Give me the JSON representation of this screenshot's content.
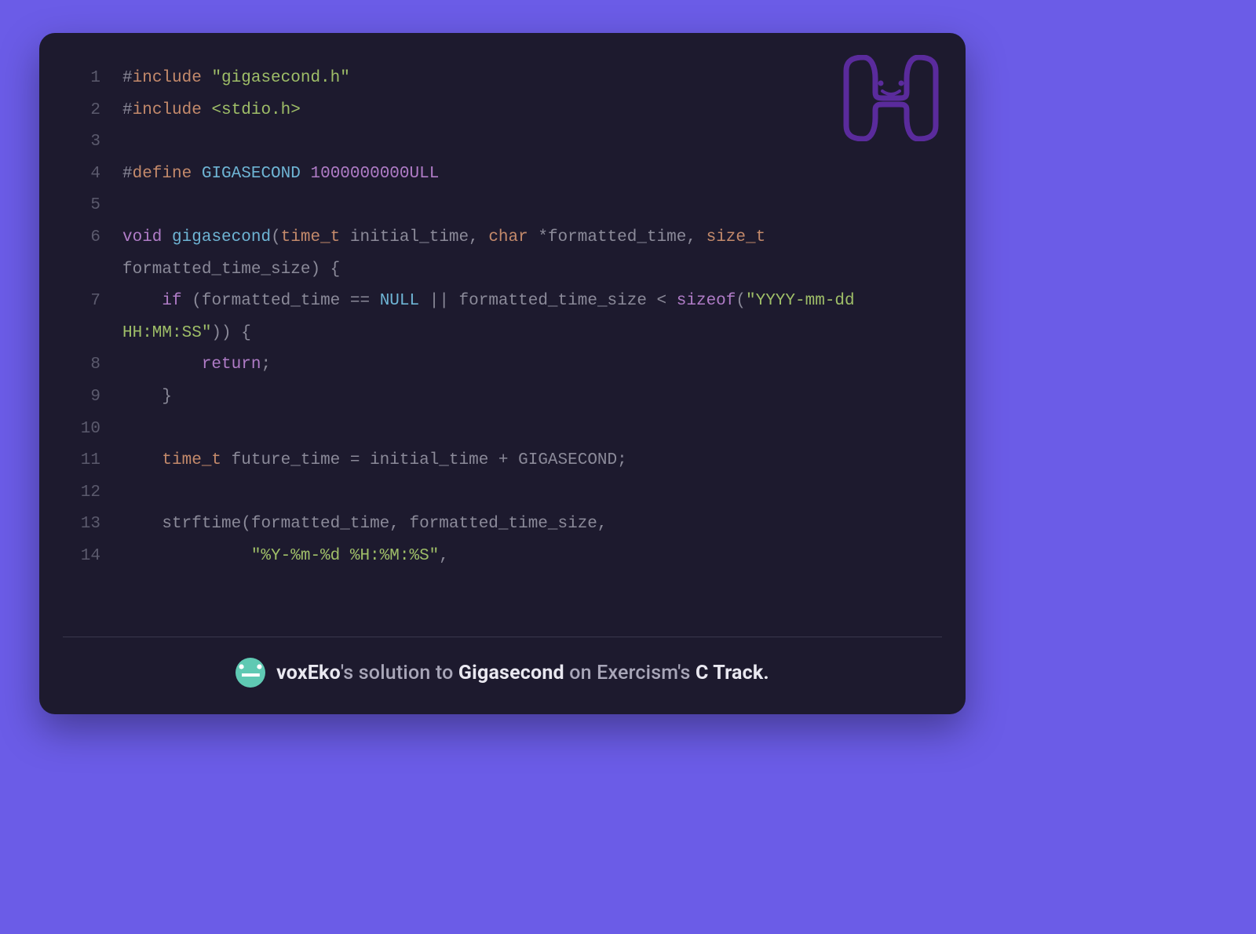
{
  "code": {
    "lines": [
      {
        "n": 1,
        "tokens": [
          {
            "t": "#",
            "c": "tok-pp"
          },
          {
            "t": "include",
            "c": "tok-ppk"
          },
          {
            "t": " ",
            "c": ""
          },
          {
            "t": "\"gigasecond.h\"",
            "c": "tok-str"
          }
        ]
      },
      {
        "n": 2,
        "tokens": [
          {
            "t": "#",
            "c": "tok-pp"
          },
          {
            "t": "include",
            "c": "tok-ppk"
          },
          {
            "t": " ",
            "c": ""
          },
          {
            "t": "<stdio.h>",
            "c": "tok-str"
          }
        ]
      },
      {
        "n": 3,
        "tokens": []
      },
      {
        "n": 4,
        "tokens": [
          {
            "t": "#",
            "c": "tok-pp"
          },
          {
            "t": "define",
            "c": "tok-ppk"
          },
          {
            "t": " ",
            "c": ""
          },
          {
            "t": "GIGASECOND",
            "c": "tok-macname"
          },
          {
            "t": " ",
            "c": ""
          },
          {
            "t": "1000000000ULL",
            "c": "tok-num"
          }
        ]
      },
      {
        "n": 5,
        "tokens": []
      },
      {
        "n": 6,
        "tokens": [
          {
            "t": "void",
            "c": "tok-kw"
          },
          {
            "t": " ",
            "c": ""
          },
          {
            "t": "gigasecond",
            "c": "tok-fn"
          },
          {
            "t": "(",
            "c": "tok-op"
          },
          {
            "t": "time_t",
            "c": "tok-type"
          },
          {
            "t": " initial_time, ",
            "c": "tok-ident"
          },
          {
            "t": "char",
            "c": "tok-type"
          },
          {
            "t": " *formatted_time, ",
            "c": "tok-ident"
          },
          {
            "t": "size_t",
            "c": "tok-type"
          },
          {
            "t": " formatted_time_size) {",
            "c": "tok-ident"
          }
        ]
      },
      {
        "n": 7,
        "tokens": [
          {
            "t": "    ",
            "c": ""
          },
          {
            "t": "if",
            "c": "tok-kw"
          },
          {
            "t": " (formatted_time == ",
            "c": "tok-ident"
          },
          {
            "t": "NULL",
            "c": "tok-null"
          },
          {
            "t": " || formatted_time_size < ",
            "c": "tok-ident"
          },
          {
            "t": "sizeof",
            "c": "tok-szof"
          },
          {
            "t": "(",
            "c": "tok-op"
          },
          {
            "t": "\"YYYY-mm-dd HH:MM:SS\"",
            "c": "tok-str"
          },
          {
            "t": ")) {",
            "c": "tok-ident"
          }
        ]
      },
      {
        "n": 8,
        "tokens": [
          {
            "t": "        ",
            "c": ""
          },
          {
            "t": "return",
            "c": "tok-kwret"
          },
          {
            "t": ";",
            "c": "tok-ident"
          }
        ]
      },
      {
        "n": 9,
        "tokens": [
          {
            "t": "    }",
            "c": "tok-ident"
          }
        ]
      },
      {
        "n": 10,
        "tokens": []
      },
      {
        "n": 11,
        "tokens": [
          {
            "t": "    ",
            "c": ""
          },
          {
            "t": "time_t",
            "c": "tok-type"
          },
          {
            "t": " future_time = initial_time + GIGASECOND;",
            "c": "tok-ident"
          }
        ]
      },
      {
        "n": 12,
        "tokens": []
      },
      {
        "n": 13,
        "tokens": [
          {
            "t": "    strftime(formatted_time, formatted_time_size,",
            "c": "tok-ident"
          }
        ]
      },
      {
        "n": 14,
        "tokens": [
          {
            "t": "             ",
            "c": ""
          },
          {
            "t": "\"%Y-%m-%d %H:%M:%S\"",
            "c": "tok-str"
          },
          {
            "t": ",",
            "c": "tok-ident"
          }
        ]
      }
    ]
  },
  "footer": {
    "user": "voxEko",
    "mid1": "'s solution to ",
    "exercise": "Gigasecond",
    "mid2": " on Exercism's ",
    "track": "C Track.",
    "avatar_color": "#5fc9b3"
  }
}
